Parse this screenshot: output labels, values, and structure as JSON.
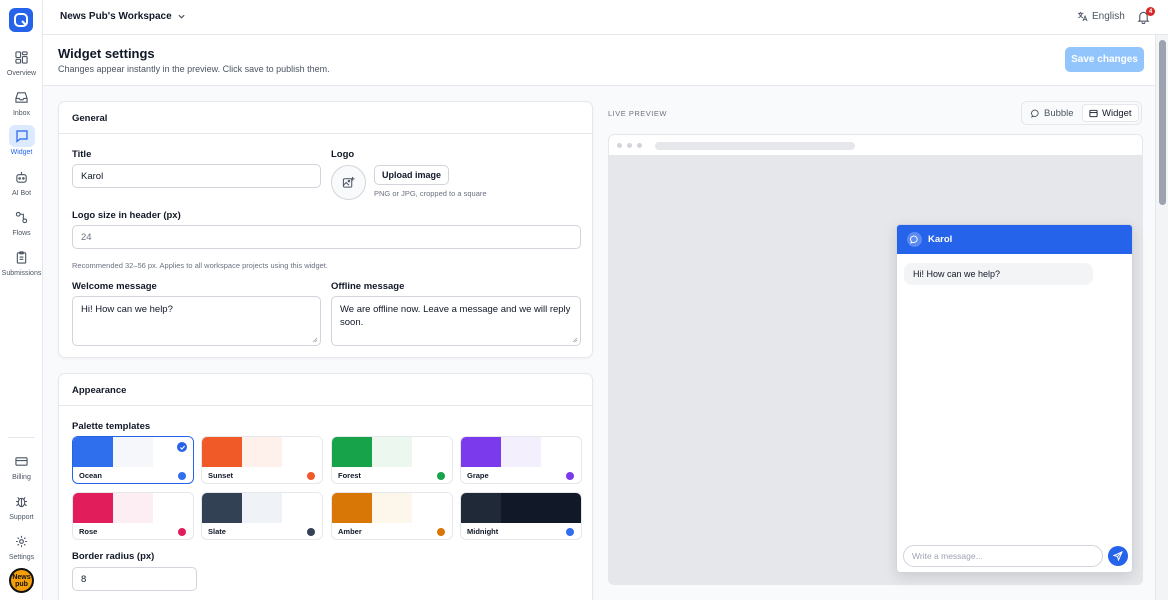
{
  "brand": {
    "accent": "#2563eb"
  },
  "sidebar": {
    "items": [
      {
        "label": "Overview",
        "icon": "grid-icon"
      },
      {
        "label": "Inbox",
        "icon": "inbox-icon"
      },
      {
        "label": "Widget",
        "icon": "chat-bubble-icon",
        "active": true
      },
      {
        "label": "AI Bot",
        "icon": "robot-icon"
      },
      {
        "label": "Flows",
        "icon": "flow-icon"
      },
      {
        "label": "Submissions",
        "icon": "clipboard-icon"
      }
    ],
    "bottom_items": [
      {
        "label": "Billing",
        "icon": "credit-card-icon"
      },
      {
        "label": "Support",
        "icon": "bug-icon"
      },
      {
        "label": "Settings",
        "icon": "gear-icon"
      }
    ],
    "avatar_line1": "News",
    "avatar_line2": "pub"
  },
  "topbar": {
    "workspace": "News Pub's Workspace",
    "language": "English",
    "notification_count": "4"
  },
  "header": {
    "title": "Widget settings",
    "subtitle": "Changes appear instantly in the preview. Click save to publish them.",
    "save_label": "Save changes"
  },
  "general": {
    "section_title": "General",
    "title_label": "Title",
    "title_value": "Karol",
    "logo_label": "Logo",
    "upload_label": "Upload image",
    "logo_hint": "PNG or JPG, cropped to a square",
    "logo_size_label": "Logo size in header (px)",
    "logo_size_value": "24",
    "logo_size_hint": "Recommended 32–56 px. Applies to all workspace projects using this widget.",
    "welcome_label": "Welcome message",
    "welcome_value": "Hi! How can we help?",
    "offline_label": "Offline message",
    "offline_value": "We are offline now. Leave a message and we will reply soon."
  },
  "appearance": {
    "section_title": "Appearance",
    "palette_label": "Palette templates",
    "palettes": [
      {
        "name": "Ocean",
        "c1": "#2f6fed",
        "c2": "#f5f7fb",
        "dot": "#2f6fed",
        "selected": true
      },
      {
        "name": "Sunset",
        "c1": "#f05a28",
        "c2": "#fef1ec",
        "dot": "#f05a28"
      },
      {
        "name": "Forest",
        "c1": "#16a34a",
        "c2": "#ecf8ef",
        "dot": "#16a34a"
      },
      {
        "name": "Grape",
        "c1": "#7c3aed",
        "c2": "#f3effd",
        "dot": "#7c3aed"
      },
      {
        "name": "Rose",
        "c1": "#e11d5c",
        "c2": "#fdeef3",
        "dot": "#e11d5c"
      },
      {
        "name": "Slate",
        "c1": "#334155",
        "c2": "#eff2f6",
        "dot": "#334155"
      },
      {
        "name": "Amber",
        "c1": "#d97706",
        "c2": "#fdf6ea",
        "dot": "#d97706"
      },
      {
        "name": "Midnight",
        "c1": "#1f2937",
        "c2": "#111827",
        "c3": "#111827",
        "dot": "#2f6fed"
      }
    ],
    "radius_label": "Border radius (px)",
    "radius_value": "8"
  },
  "preview": {
    "label": "LIVE PREVIEW",
    "toggle_bubble": "Bubble",
    "toggle_widget": "Widget",
    "widget_title": "Karol",
    "welcome_message": "Hi! How can we help?",
    "input_placeholder": "Write a message..."
  }
}
